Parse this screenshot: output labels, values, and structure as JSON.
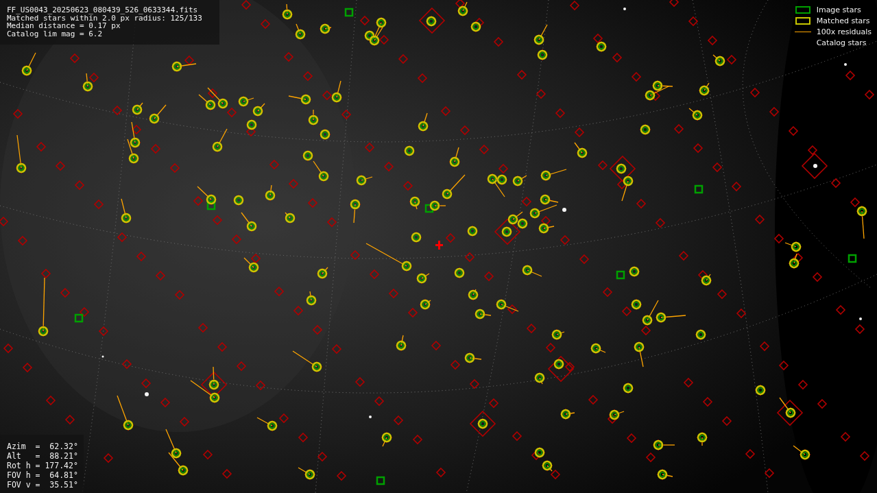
{
  "info": {
    "lines": [
      "FF_US0043_20250623_080439_526_0633344.fits",
      "Matched stars within 2.0 px radius: 125/133",
      "Median distance = 0.17 px",
      "Catalog lim mag = 6.2"
    ]
  },
  "legend": [
    {
      "label": "Image stars",
      "kind": "box",
      "color": "#00a000"
    },
    {
      "label": "Matched stars",
      "kind": "box",
      "color": "#c8c800"
    },
    {
      "label": "100x residuals",
      "kind": "line",
      "color": "#ffa500"
    },
    {
      "label": "Catalog stars",
      "kind": "none"
    }
  ],
  "pointing": {
    "lines": [
      "Azim  =  62.32°",
      "Alt   =  88.21°",
      "Rot h = 177.42°",
      "FOV h =  64.81°",
      "FOV v =  35.51°"
    ]
  }
}
